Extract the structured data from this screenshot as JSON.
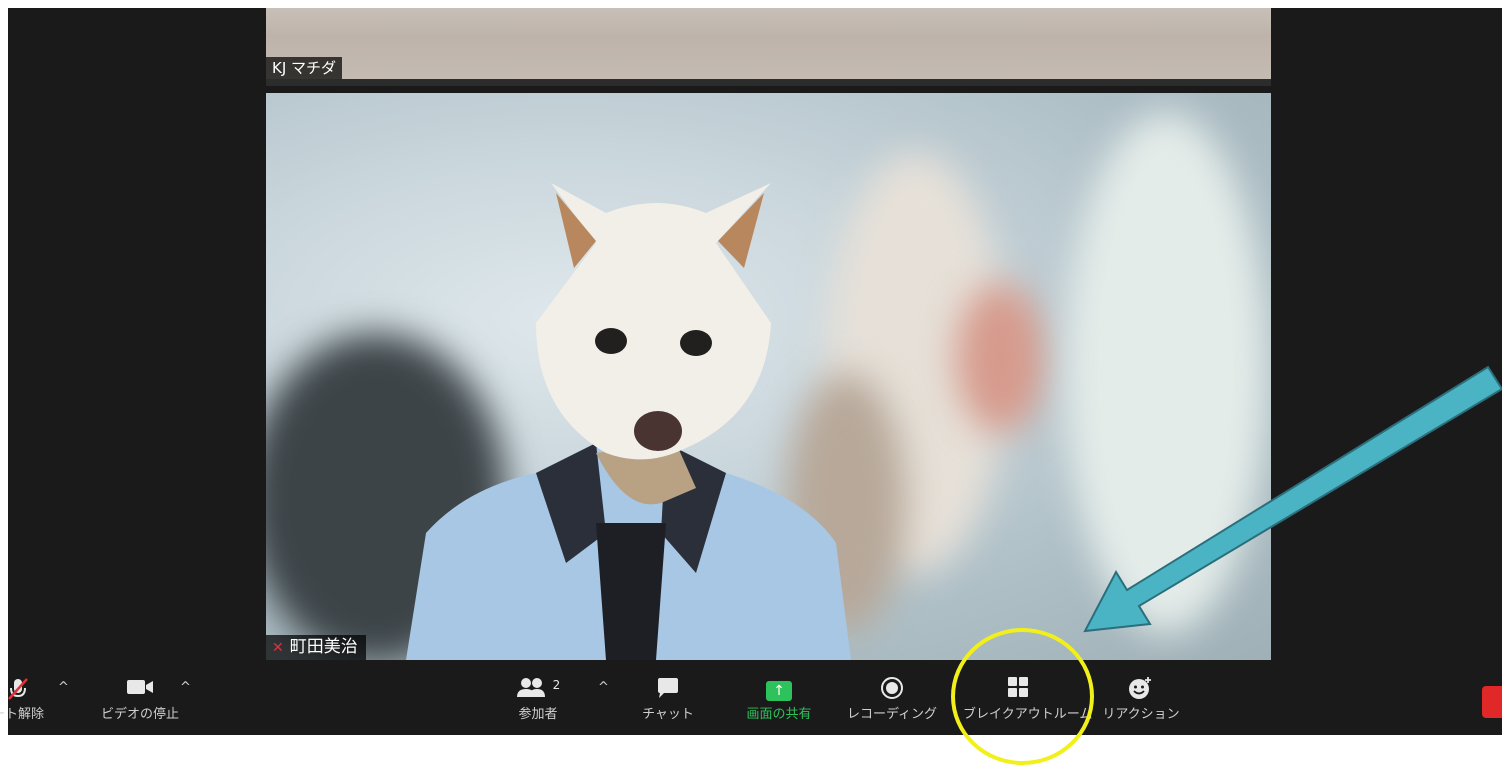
{
  "top_tile": {
    "participant_name": "KJ マチダ"
  },
  "main_tile": {
    "participant_name": "町田美治",
    "mic_muted_icon": "mic-muted-icon"
  },
  "toolbar": {
    "mute": {
      "label": "ート解除",
      "icon": "mic-muted-icon"
    },
    "video": {
      "label": "ビデオの停止",
      "icon": "video-camera-icon"
    },
    "participants": {
      "label": "参加者",
      "count": "2",
      "icon": "people-icon"
    },
    "chat": {
      "label": "チャット",
      "icon": "chat-bubble-icon"
    },
    "share": {
      "label": "画面の共有",
      "icon": "share-arrow-icon",
      "color": "#2ec25c"
    },
    "record": {
      "label": "レコーディング",
      "icon": "record-icon"
    },
    "breakout": {
      "label": "ブレイクアウトルーム",
      "icon": "grid-icon"
    },
    "reactions": {
      "label": "リアクション",
      "icon": "smiley-icon"
    },
    "end": {
      "color": "#e02828"
    }
  },
  "annotations": {
    "arrow_color": "#4ab3c4",
    "circle_color": "#f2f01a"
  }
}
